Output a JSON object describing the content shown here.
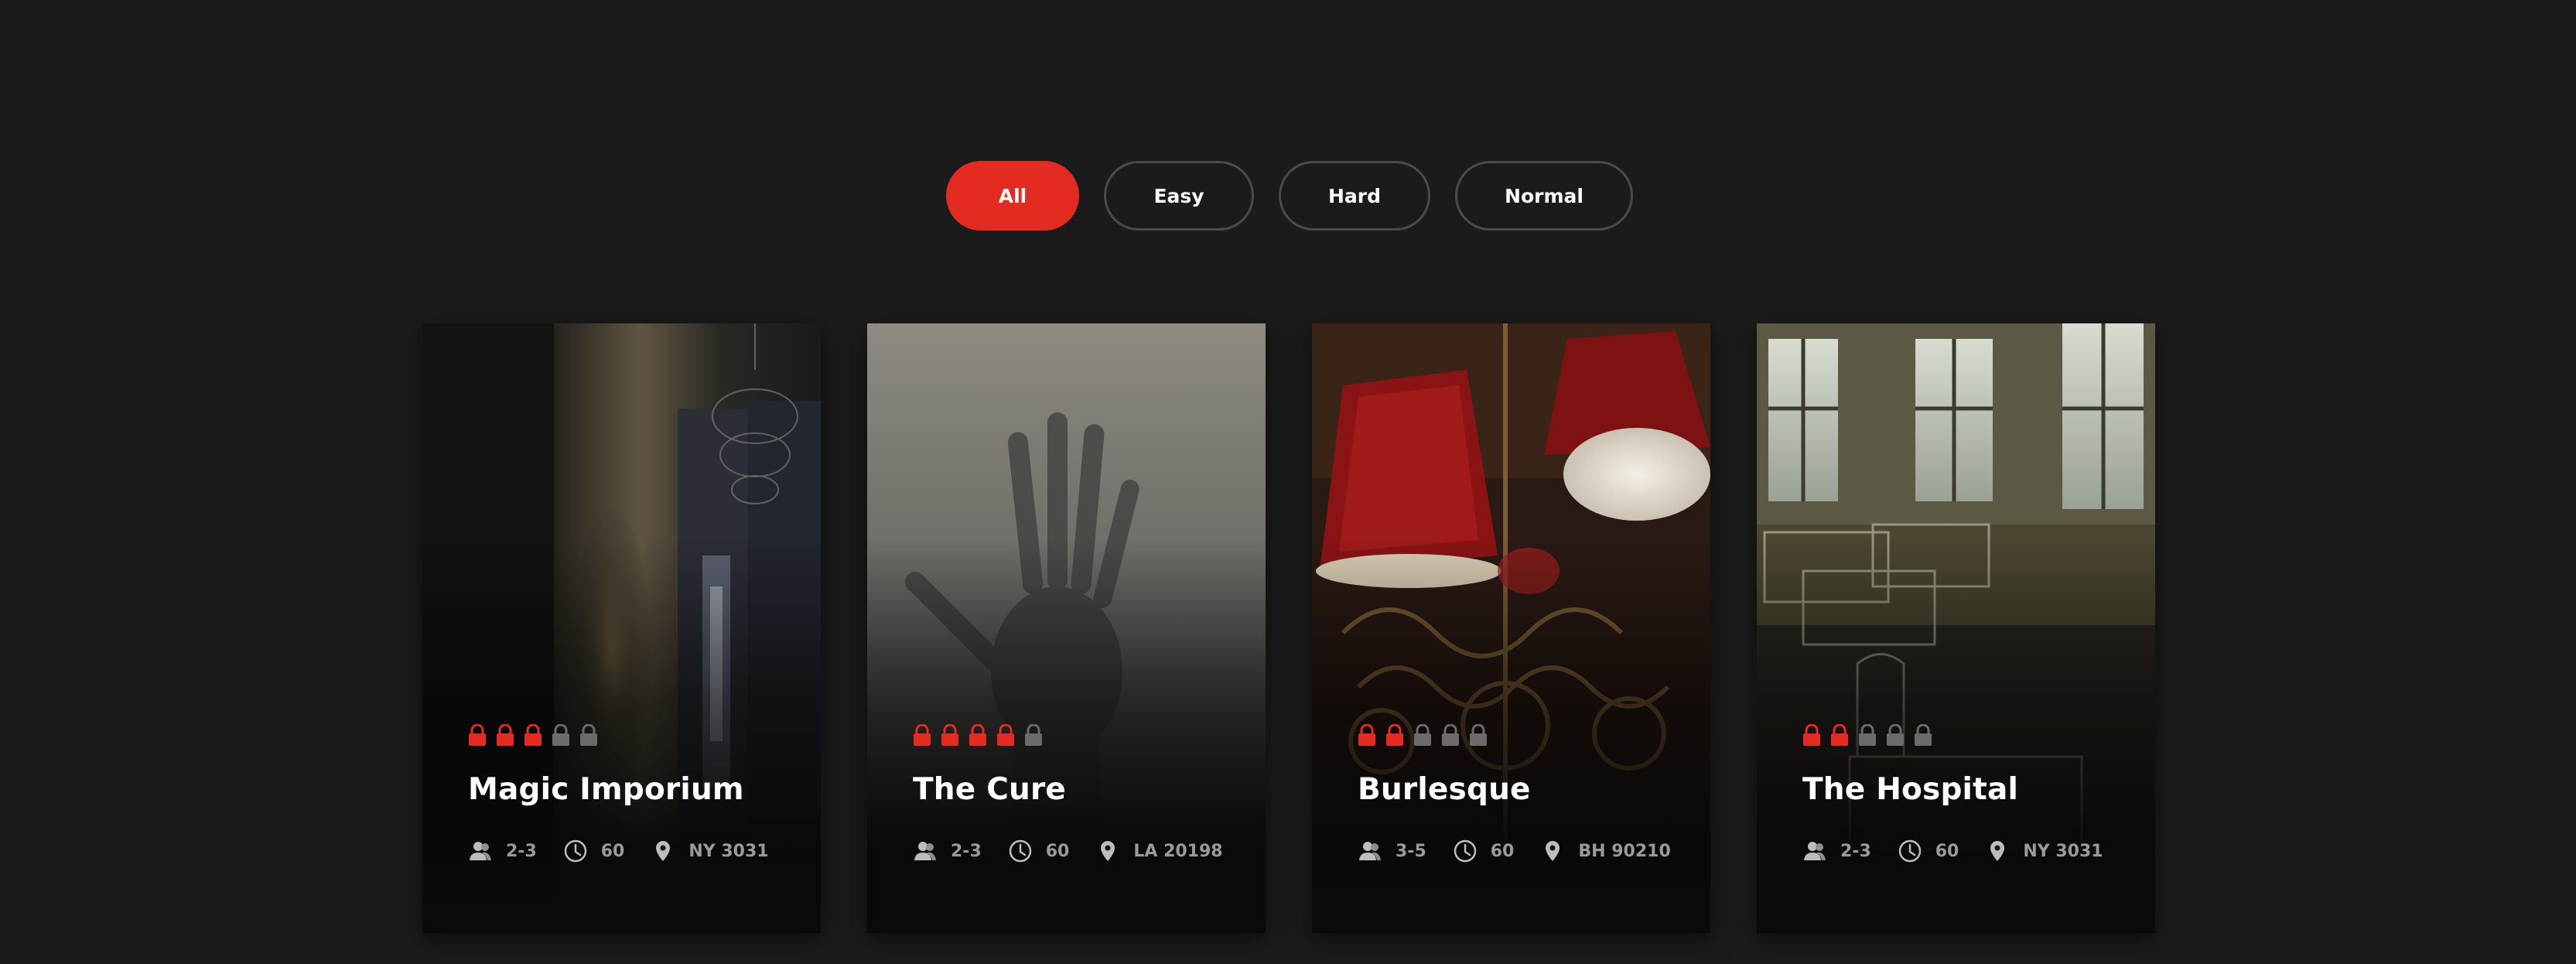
{
  "filters": [
    {
      "label": "All",
      "active": true
    },
    {
      "label": "Easy",
      "active": false
    },
    {
      "label": "Hard",
      "active": false
    },
    {
      "label": "Normal",
      "active": false
    }
  ],
  "colors": {
    "accent": "#e32b22",
    "background": "#1b1b1b",
    "lock_inactive": "#6b6b6b",
    "meta_text": "#9a9a9a"
  },
  "icons": {
    "players": "players-icon",
    "duration": "clock-icon",
    "location": "location-pin-icon",
    "difficulty": "lock-icon"
  },
  "rooms": [
    {
      "title": "Magic Imporium",
      "difficulty": 3,
      "difficulty_max": 5,
      "players": "2-3",
      "duration": "60",
      "location": "NY 3031"
    },
    {
      "title": "The Cure",
      "difficulty": 4,
      "difficulty_max": 5,
      "players": "2-3",
      "duration": "60",
      "location": "LA 20198"
    },
    {
      "title": "Burlesque",
      "difficulty": 2,
      "difficulty_max": 5,
      "players": "3-5",
      "duration": "60",
      "location": "BH 90210"
    },
    {
      "title": "The Hospital",
      "difficulty": 2,
      "difficulty_max": 5,
      "players": "2-3",
      "duration": "60",
      "location": "NY 3031"
    }
  ]
}
